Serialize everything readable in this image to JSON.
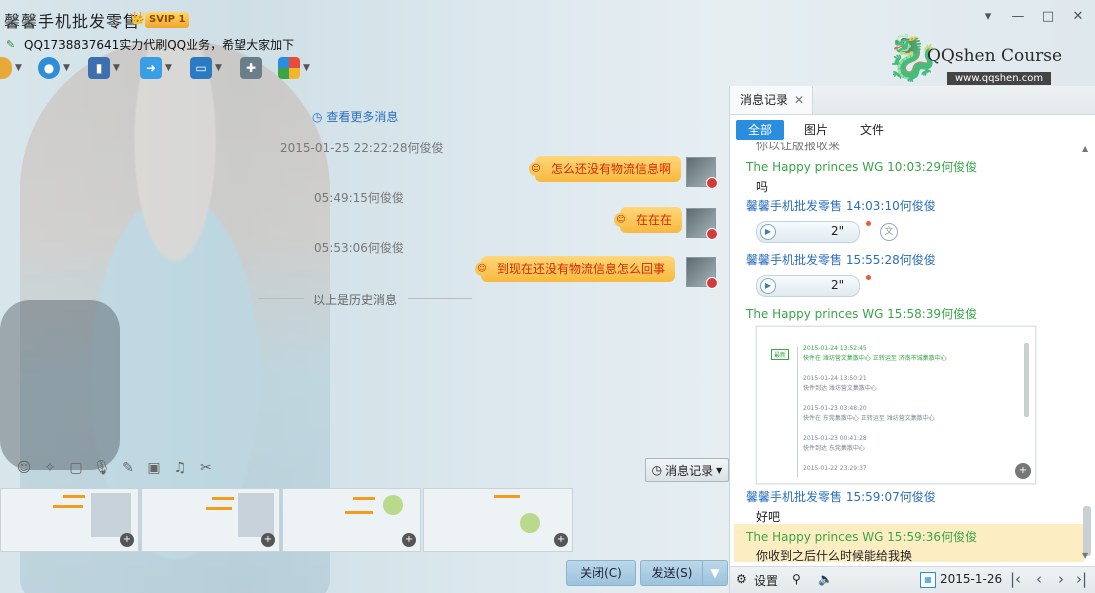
{
  "window": {
    "title": "馨馨手机批发零售",
    "vip_badge": "SVIP 1",
    "status": "QQ1738837641实力代刷QQ业务，希望大家加下",
    "controls": {
      "menu": "▾",
      "minimize": "—",
      "maximize": "□",
      "close": "✕"
    }
  },
  "logo": {
    "name": "QQshen Course",
    "url": "www.qqshen.com"
  },
  "toolbar": {
    "items": [
      "phone-icon",
      "video-icon",
      "screen-share-icon",
      "file-transfer-icon",
      "remote-desktop-icon",
      "add-app-icon",
      "apps-icon"
    ]
  },
  "chat": {
    "more_link": "查看更多消息",
    "history_marker": "以上是历史消息",
    "messages": [
      {
        "timestamp": "2015-01-25 22:22:28何俊俊",
        "text": "怎么还没有物流信息啊"
      },
      {
        "timestamp": "05:49:15何俊俊",
        "text": "在在在"
      },
      {
        "timestamp": "05:53:06何俊俊",
        "text": "到现在还没有物流信息怎么回事"
      }
    ]
  },
  "input": {
    "history_button": "消息记录",
    "close_button": "关闭(C)",
    "send_button": "发送(S)"
  },
  "thumbnails": [
    "thumb-1",
    "thumb-2",
    "thumb-3",
    "thumb-4"
  ],
  "records": {
    "tab": "消息记录",
    "filters": [
      "全部",
      "图片",
      "文件"
    ],
    "cut_top": "你以让版报收来",
    "entries": [
      {
        "sender": "The Happy princes  WG 10:03:29何俊俊",
        "text": "吗"
      },
      {
        "sender": "馨馨手机批发零售 14:03:10何俊俊",
        "voice": "2\""
      },
      {
        "sender": "馨馨手机批发零售 15:55:28何俊俊",
        "voice": "2\""
      },
      {
        "sender": "The Happy princes  WG 15:58:39何俊俊"
      },
      {
        "sender": "馨馨手机批发零售 15:59:07何俊俊",
        "text": "好吧"
      },
      {
        "sender": "The Happy princes  WG 15:59:36何俊俊",
        "text": "你收到之后什么时候能给我换"
      }
    ],
    "screenshot": {
      "tag": "最新",
      "rows": [
        {
          "date": "2015-01-24 13:52:45",
          "text": "快件在 潍坊营文集散中心 正转运至 济南市城集散中心"
        },
        {
          "date": "2015-01-24 13:50:21",
          "text": "快件到达 潍坊营文集散中心"
        },
        {
          "date": "2015-01-23 03:48:20",
          "text": "快件在 东莞集散中心 正转运至 潍坊营文集散中心"
        },
        {
          "date": "2015-01-23 00:41:28",
          "text": "快件到达 东莞集散中心"
        },
        {
          "date": "2015-01-22 23:29:37",
          "text": ""
        }
      ]
    },
    "footer": {
      "settings": "设置",
      "date": "2015-1-26"
    }
  }
}
